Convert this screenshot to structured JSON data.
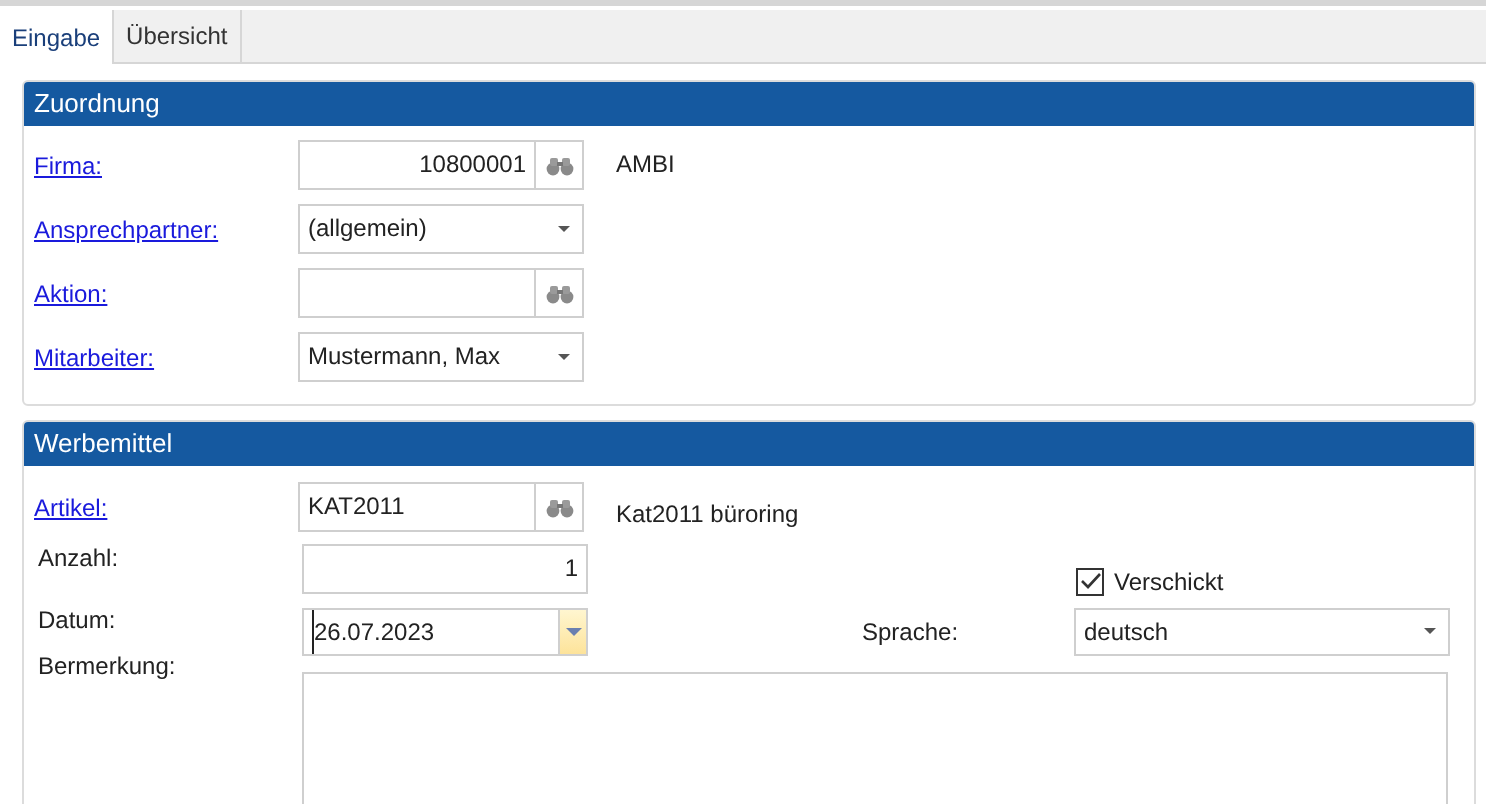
{
  "tabs": [
    {
      "label": "Eingabe",
      "selected": true
    },
    {
      "label": "Übersicht",
      "selected": false
    }
  ],
  "zuordnung": {
    "title": "Zuordnung",
    "rows": [
      {
        "label": "Firma:",
        "link": true,
        "kind": "lookup",
        "value": "10800001",
        "right_aligned": true,
        "note": "AMBI"
      },
      {
        "label": "Ansprechpartner:",
        "link": true,
        "kind": "dropdown",
        "value": "(allgemein)"
      },
      {
        "label": "Aktion:",
        "link": true,
        "kind": "lookup"
      },
      {
        "label": "Mitarbeiter:",
        "link": true,
        "kind": "dropdown",
        "value": "Mustermann, Max"
      }
    ]
  },
  "werbemittel": {
    "title": "Werbemittel",
    "rows": [
      {
        "label": "Artikel:",
        "link": true,
        "kind": "lookup",
        "value": "KAT2011",
        "right_aligned": false,
        "note": "Kat2011 büroring"
      },
      {
        "label": "Anzahl:",
        "link": false,
        "kind": "text",
        "value": "1",
        "right_aligned": true
      },
      {
        "label": "Datum:",
        "link": false,
        "kind": "date",
        "value": "26.07.2023"
      }
    ],
    "verschickt": {
      "label": "Verschickt",
      "checked": true
    },
    "sprache": {
      "label": "Sprache:",
      "value": "deutsch"
    },
    "bemerkung": {
      "label": "Bermerkung:"
    }
  }
}
